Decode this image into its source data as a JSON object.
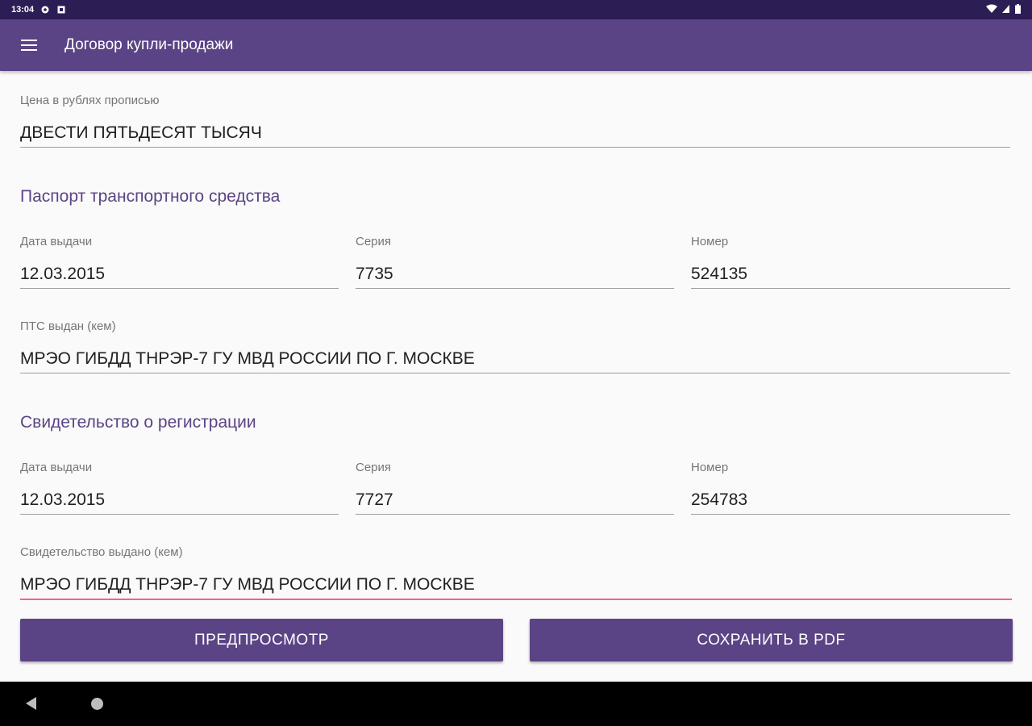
{
  "status_bar": {
    "time": "13:04",
    "icons_left": [
      "settings-icon",
      "sim-icon"
    ],
    "icons_right": [
      "wifi-icon",
      "signal-icon",
      "battery-icon"
    ]
  },
  "app_bar": {
    "title": "Договор купли-продажи",
    "menu_icon": "hamburger-menu-icon",
    "background": "#5b4485"
  },
  "price": {
    "label": "Цена в рублях прописью",
    "value": "ДВЕСТИ ПЯТЬДЕСЯТ ТЫСЯЧ"
  },
  "pts": {
    "title": "Паспорт транспортного средства",
    "date": {
      "label": "Дата выдачи",
      "value": "12.03.2015"
    },
    "series": {
      "label": "Серия",
      "value": "7735"
    },
    "number": {
      "label": "Номер",
      "value": "524135"
    },
    "issuer": {
      "label": "ПТС выдан (кем)",
      "value": "МРЭО ГИБДД ТНРЭР-7 ГУ МВД РОССИИ ПО Г. МОСКВЕ"
    }
  },
  "registration": {
    "title": "Свидетельство о регистрации",
    "date": {
      "label": "Дата выдачи",
      "value": "12.03.2015"
    },
    "series": {
      "label": "Серия",
      "value": "7727"
    },
    "number": {
      "label": "Номер",
      "value": "254783"
    },
    "issuer": {
      "label": "Свидетельство выдано (кем)",
      "value": "МРЭО ГИБДД ТНРЭР-7 ГУ МВД РОССИИ ПО Г. МОСКВЕ"
    }
  },
  "buttons": {
    "preview": "ПРЕДПРОСМОТР",
    "save_pdf": "СОХРАНИТЬ В PDF"
  },
  "nav_bar": {
    "icons": [
      "back-icon",
      "home-icon"
    ]
  },
  "colors": {
    "accent": "#5b4485",
    "status_bar": "#2c1d55",
    "focus_underline": "#f06292"
  }
}
